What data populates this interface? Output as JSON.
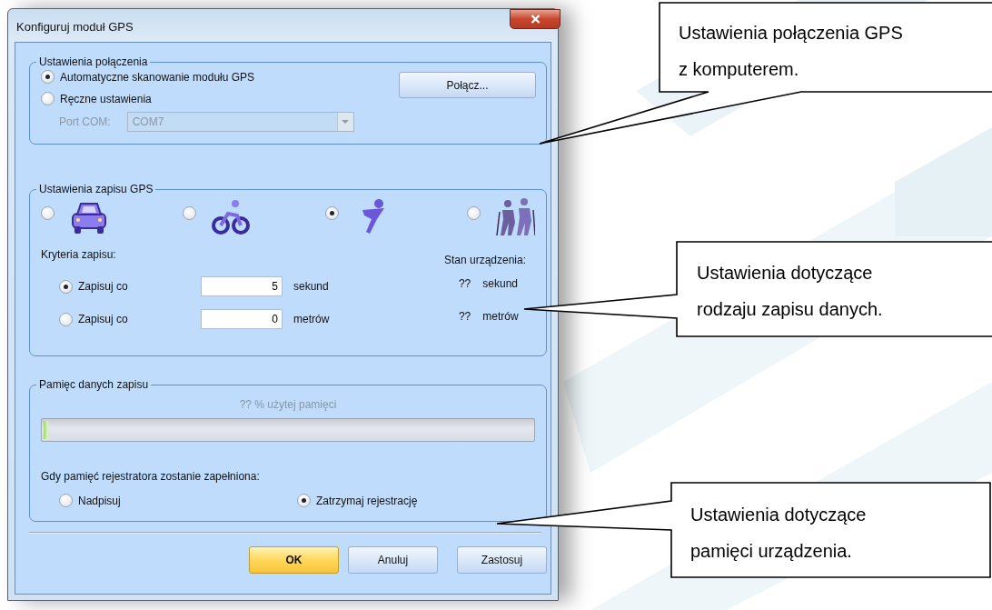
{
  "window": {
    "title": "Konfiguruj moduł GPS"
  },
  "connection": {
    "title": "Ustawienia połączenia",
    "options": [
      {
        "label": "Automatyczne skanowanie modułu GPS",
        "selected": true
      },
      {
        "label": "Ręczne ustawienia",
        "selected": false
      }
    ],
    "connect_button": "Połącz...",
    "port": {
      "label": "Port COM:",
      "value": "COM7",
      "disabled": true
    }
  },
  "recording": {
    "title": "Ustawienia zapisu GPS",
    "modes": [
      {
        "selected": false
      },
      {
        "selected": false
      },
      {
        "selected": true
      },
      {
        "selected": false
      }
    ],
    "criteria_label": "Kryteria zapisu:",
    "criteria": [
      {
        "label": "Zapisuj co",
        "value": "5",
        "unit": "sekund",
        "selected": true
      },
      {
        "label": "Zapisuj co",
        "value": "0",
        "unit": "metrów",
        "selected": false
      }
    ],
    "device_status": {
      "title": "Stan urządzenia:",
      "rows": [
        {
          "value": "??",
          "unit": "sekund"
        },
        {
          "value": "??",
          "unit": "metrów"
        }
      ]
    }
  },
  "memory": {
    "title": "Pamięc danych zapisu",
    "usage": "?? % użytej pamięci",
    "level": 0.01,
    "full_prompt": "Gdy pamięć rejestratora zostanie zapełniona:",
    "options": [
      {
        "label": "Nadpisuj",
        "selected": false
      },
      {
        "label": "Zatrzymaj rejestrację",
        "selected": true
      }
    ]
  },
  "buttons": [
    {
      "label": "OK",
      "default": true
    },
    {
      "label": "Anuluj",
      "default": false
    },
    {
      "label": "Zastosuj",
      "default": false
    }
  ],
  "callouts": [
    {
      "text": "Ustawienia połączenia GPS\nz komputerem."
    },
    {
      "text": "Ustawienia dotyczące\nrodzaju zapisu danych."
    },
    {
      "text": "Ustawienia dotyczące\npamięci urządzenia."
    }
  ]
}
